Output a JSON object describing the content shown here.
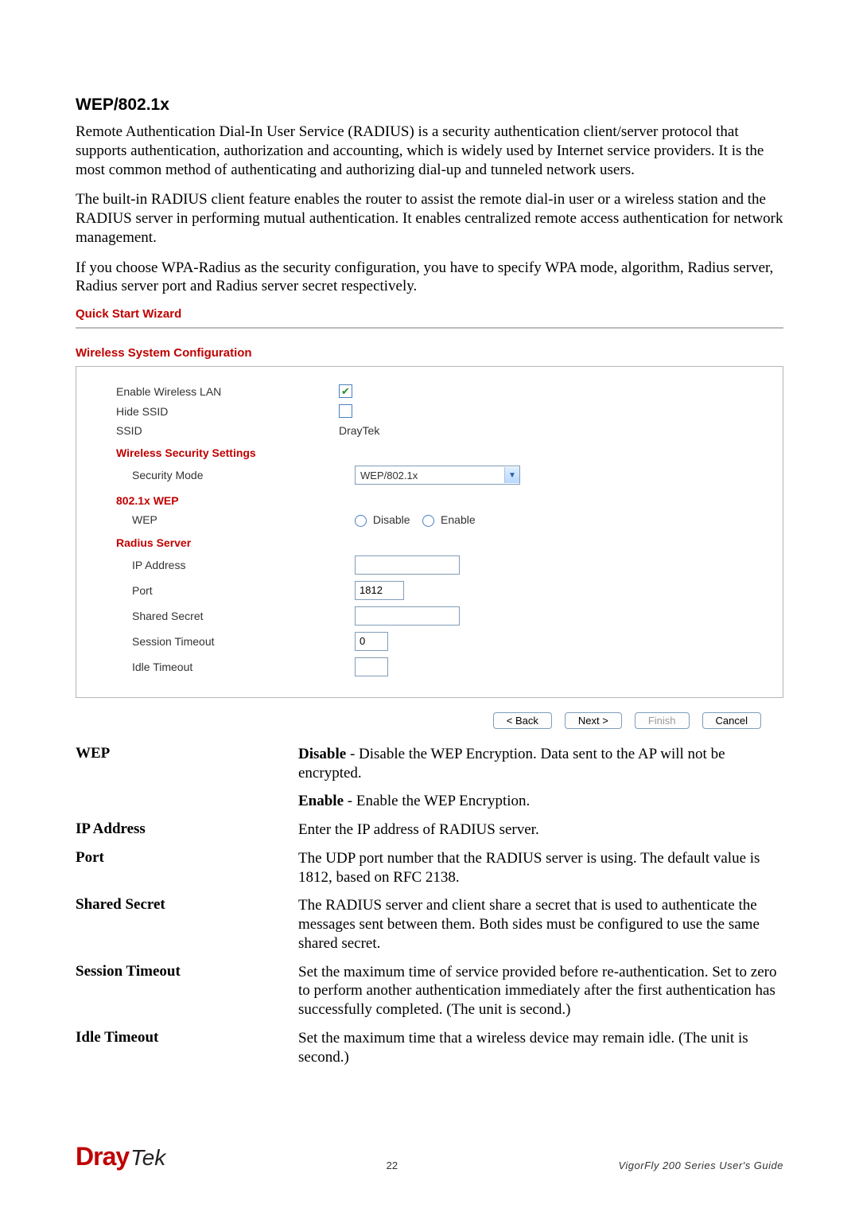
{
  "section_title": "WEP/802.1x",
  "para1": "Remote Authentication Dial-In User Service (RADIUS) is a security authentication client/server protocol that supports authentication, authorization and accounting, which is widely used by Internet service providers. It is the most common method of authenticating and authorizing dial-up and tunneled network users.",
  "para2": "The built-in RADIUS client feature enables the router to assist the remote dial-in user or a wireless station and the RADIUS server in performing mutual authentication. It enables centralized remote access authentication for network management.",
  "para3": "If you choose WPA-Radius as the security configuration, you have to specify WPA mode, algorithm, Radius server, Radius server port and Radius server secret respectively.",
  "wizard_title": "Quick Start Wizard",
  "panel_title": "Wireless System Configuration",
  "panel": {
    "enable_label": "Enable Wireless LAN",
    "hide_label": "Hide SSID",
    "ssid_label": "SSID",
    "ssid_value": "DrayTek",
    "sec_heading": "Wireless Security Settings",
    "sec_mode_label": "Security Mode",
    "sec_mode_value": "WEP/802.1x",
    "wep_heading": "802.1x WEP",
    "wep_label": "WEP",
    "wep_disable": "Disable",
    "wep_enable": "Enable",
    "radius_heading": "Radius Server",
    "ip_label": "IP Address",
    "ip_value": "",
    "port_label": "Port",
    "port_value": "1812",
    "secret_label": "Shared Secret",
    "secret_value": "",
    "session_label": "Session Timeout",
    "session_value": "0",
    "idle_label": "Idle Timeout",
    "idle_value": ""
  },
  "buttons": {
    "back": "< Back",
    "next": "Next >",
    "finish": "Finish",
    "cancel": "Cancel"
  },
  "defs": {
    "wep_term": "WEP",
    "wep_disable_b": "Disable",
    "wep_disable_t": " - Disable the WEP Encryption. Data sent to the AP will not be encrypted.",
    "wep_enable_b": "Enable",
    "wep_enable_t": " - Enable the WEP Encryption.",
    "ip_term": "IP Address",
    "ip_body": "Enter the IP address of RADIUS server.",
    "port_term": "Port",
    "port_body": "The UDP port number that the RADIUS server is using. The default value is 1812, based on RFC 2138.",
    "secret_term": "Shared Secret",
    "secret_body": "The RADIUS server and client share a secret that is used to authenticate the messages sent between them. Both sides must be configured to use the same shared secret.",
    "session_term": "Session Timeout",
    "session_body": "Set the maximum time of service provided before re-authentication. Set to zero to perform another authentication immediately after the first authentication has successfully completed. (The unit is second.)",
    "idle_term": "Idle Timeout",
    "idle_body": "Set the maximum time that a wireless device may remain idle. (The unit is second.)"
  },
  "footer": {
    "brand_a": "Dray",
    "brand_b": "Tek",
    "page": "22",
    "guide": "VigorFly 200 Series User's Guide"
  }
}
